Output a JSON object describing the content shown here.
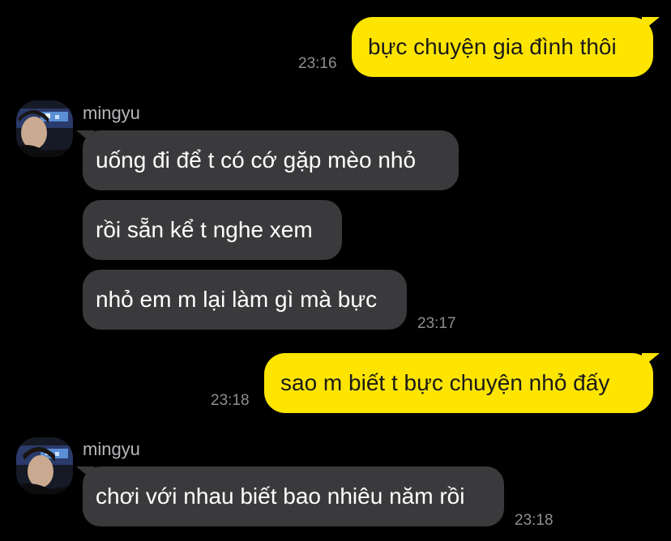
{
  "conversation": {
    "messages": [
      {
        "from": "me",
        "text": "bực chuyện gia đình thôi",
        "time": "23:16"
      },
      {
        "from": "mingyu",
        "text": "uống đi để t có cớ gặp mèo nhỏ"
      },
      {
        "from": "mingyu",
        "text": "rồi sẵn kể t nghe xem"
      },
      {
        "from": "mingyu",
        "text": "nhỏ em m lại làm gì mà bực",
        "time": "23:17"
      },
      {
        "from": "me",
        "text": "sao m biết t bực chuyện nhỏ đấy",
        "time": "23:18"
      },
      {
        "from": "mingyu",
        "text": "chơi với nhau biết bao nhiêu năm rồi",
        "time": "23:18"
      }
    ],
    "groups": [
      {
        "sender": "mingyu",
        "avatar_icon": "profile-photo-icon"
      },
      {
        "sender": "mingyu",
        "avatar_icon": "profile-photo-icon"
      }
    ]
  },
  "colors": {
    "background": "#000000",
    "my_bubble": "#fee500",
    "their_bubble": "#3a3a3c",
    "timestamp": "#8e8e93"
  }
}
